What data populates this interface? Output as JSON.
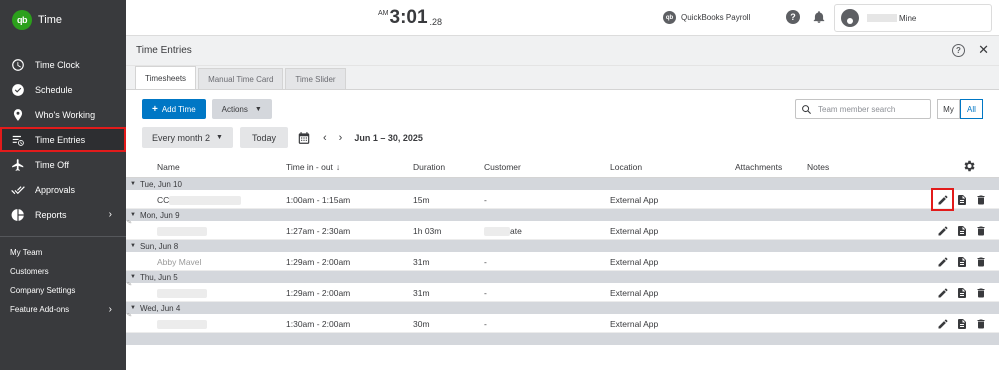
{
  "app": {
    "brand_logo": "qb",
    "brand_name": "Time"
  },
  "sidebar": {
    "items": [
      {
        "label": "Time Clock",
        "icon": "clock-icon"
      },
      {
        "label": "Schedule",
        "icon": "calendar-check-icon"
      },
      {
        "label": "Who's Working",
        "icon": "map-pin-icon"
      },
      {
        "label": "Time Entries",
        "icon": "time-entries-icon",
        "active": true
      },
      {
        "label": "Time Off",
        "icon": "plane-icon"
      },
      {
        "label": "Approvals",
        "icon": "checkmarks-icon"
      },
      {
        "label": "Reports",
        "icon": "pie-chart-icon",
        "chevron": "›"
      }
    ],
    "sub_items": [
      {
        "label": "My Team"
      },
      {
        "label": "Customers"
      },
      {
        "label": "Company Settings"
      },
      {
        "label": "Feature Add-ons",
        "chevron": "›"
      }
    ]
  },
  "topbar": {
    "clock_ampm": "AM",
    "clock_time": "3:01",
    "clock_seconds": ".28",
    "payroll_logo": "qb",
    "payroll_label": "QuickBooks Payroll",
    "help_glyph": "?",
    "user_name_suffix": "Mine"
  },
  "panel": {
    "title": "Time Entries",
    "help_glyph": "?",
    "close_glyph": "✕",
    "tabs": [
      {
        "label": "Timesheets",
        "active": true
      },
      {
        "label": "Manual Time Card"
      },
      {
        "label": "Time Slider"
      }
    ],
    "add_time_label": "Add Time",
    "add_time_plus": "+",
    "actions_label": "Actions",
    "search_placeholder": "Team member search",
    "seg_my": "My",
    "seg_all": "All",
    "period_label": "Every month 2",
    "today_label": "Today",
    "prev_glyph": "‹",
    "next_glyph": "›",
    "date_range": "Jun 1 – 30, 2025"
  },
  "table": {
    "columns": {
      "name": "Name",
      "time_in_out": "Time in - out",
      "sort_glyph": "↓",
      "duration": "Duration",
      "customer": "Customer",
      "location": "Location",
      "attachments": "Attachments",
      "notes": "Notes"
    },
    "groups": [
      {
        "date": "Tue, Jun 10",
        "row": {
          "name_prefix": "CC",
          "time": "1:00am - 1:15am",
          "duration": "15m",
          "customer": "-",
          "location": "External App",
          "highlight_edit": true
        }
      },
      {
        "date": "Mon, Jun 9",
        "row": {
          "name_prefix": "",
          "time": "1:27am - 2:30am",
          "duration": "1h 03m",
          "customer": "ate",
          "location": "External App"
        }
      },
      {
        "date": "Sun, Jun 8",
        "row": {
          "name_prefix": "Abby Mavel",
          "time": "1:29am - 2:00am",
          "duration": "31m",
          "customer": "-",
          "location": "External App"
        }
      },
      {
        "date": "Thu, Jun 5",
        "row": {
          "name_prefix": "",
          "time": "1:29am - 2:00am",
          "duration": "31m",
          "customer": "-",
          "location": "External App"
        }
      },
      {
        "date": "Wed, Jun 4",
        "row": {
          "name_prefix": "",
          "time": "1:30am - 2:00am",
          "duration": "30m",
          "customer": "-",
          "location": "External App"
        }
      }
    ]
  },
  "colors": {
    "sidebar_bg": "#393a3d",
    "primary": "#0077c5",
    "brand_green": "#2ca01c",
    "highlight_red": "#e21b1b"
  }
}
